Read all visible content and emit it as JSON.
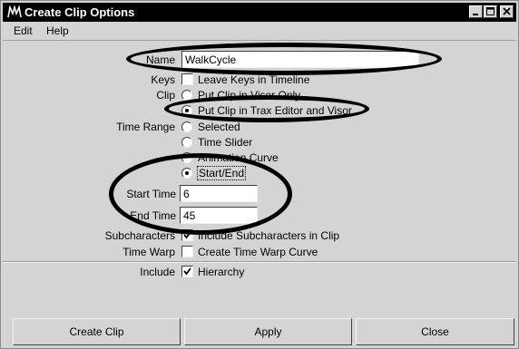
{
  "window": {
    "title": "Create Clip Options",
    "controls": {
      "minimize": "_",
      "maximize": "□",
      "close": "×"
    }
  },
  "menu": {
    "items": [
      "Edit",
      "Help"
    ]
  },
  "form": {
    "name_label": "Name",
    "name_value": "WalkCycle",
    "keys_label": "Keys",
    "keys_option": "Leave Keys in Timeline",
    "clip_label": "Clip",
    "clip_options": [
      "Put Clip in Visor Only",
      "Put Clip in Trax Editor and Visor"
    ],
    "time_range_label": "Time Range",
    "time_range_options": [
      "Selected",
      "Time Slider",
      "Animation Curve",
      "Start/End"
    ],
    "start_time_label": "Start Time",
    "start_time_value": "6",
    "end_time_label": "End Time",
    "end_time_value": "45",
    "subcharacters_label": "Subcharacters",
    "subcharacters_option": "Include Subcharacters in Clip",
    "time_warp_label": "Time Warp",
    "time_warp_option": "Create Time Warp Curve",
    "include_label": "Include",
    "include_option": "Hierarchy"
  },
  "buttons": {
    "create": "Create Clip",
    "apply": "Apply",
    "close": "Close"
  },
  "icons": {
    "app": "maya-clip-icon"
  },
  "colors": {
    "titlebar": "#000000",
    "panel": "#d4d4d4",
    "field": "#ffffff"
  }
}
